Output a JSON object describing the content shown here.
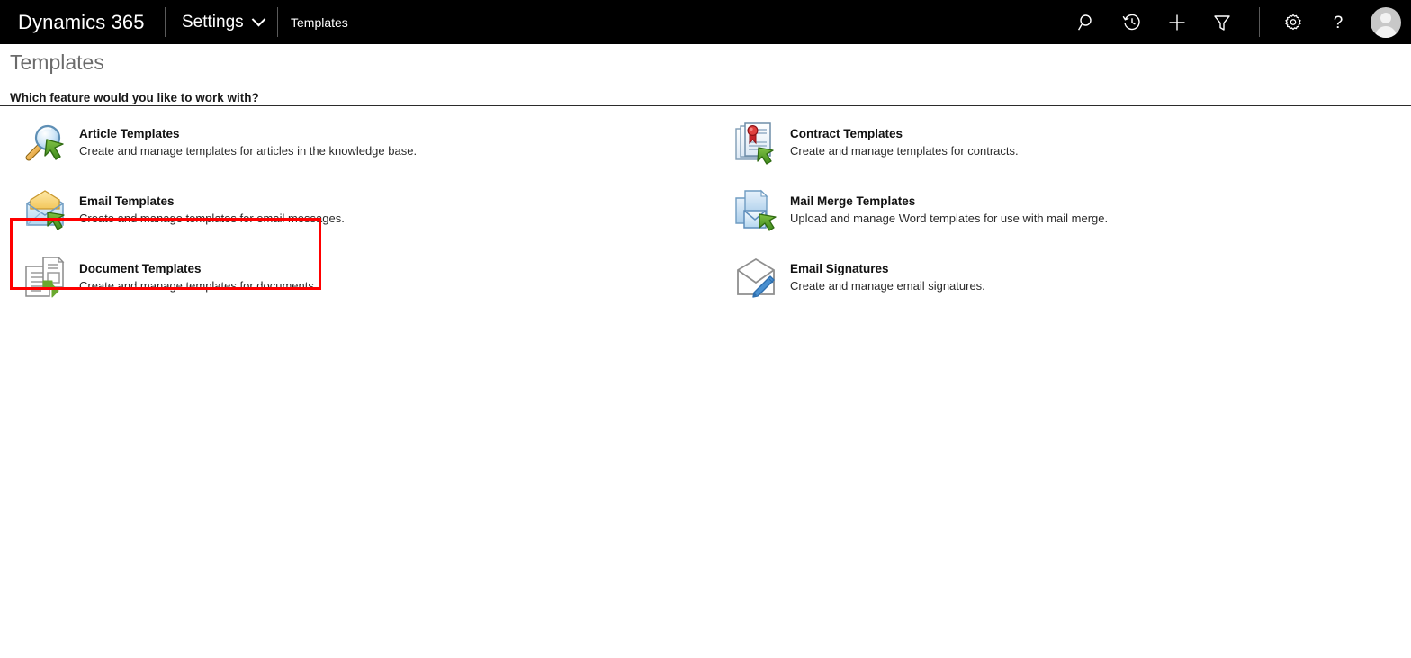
{
  "navbar": {
    "brand": "Dynamics 365",
    "module": "Settings",
    "module_chevron_icon": "chevron-down-icon",
    "breadcrumb": "Templates",
    "icons": [
      {
        "name": "search-icon",
        "label": "Search"
      },
      {
        "name": "history-icon",
        "label": "Recently viewed"
      },
      {
        "name": "plus-icon",
        "label": "Quick create"
      },
      {
        "name": "filter-icon",
        "label": "Filter"
      }
    ],
    "right_icons": [
      {
        "name": "gear-icon",
        "label": "Settings"
      },
      {
        "name": "help-icon",
        "label": "Help"
      }
    ],
    "avatar": {
      "name": "user-avatar",
      "label": "User profile"
    }
  },
  "page": {
    "title": "Templates",
    "question": "Which feature would you like to work with?"
  },
  "features": {
    "left": [
      {
        "id": "article-templates",
        "icon": "article-templates-icon",
        "title": "Article Templates",
        "description": "Create and manage templates for articles in the knowledge base."
      },
      {
        "id": "email-templates",
        "icon": "email-templates-icon",
        "title": "Email Templates",
        "description": "Create and manage templates for email messages."
      },
      {
        "id": "document-templates",
        "icon": "document-templates-icon",
        "title": "Document Templates",
        "description": "Create and manage templates for documents."
      }
    ],
    "right": [
      {
        "id": "contract-templates",
        "icon": "contract-templates-icon",
        "title": "Contract Templates",
        "description": "Create and manage templates for contracts."
      },
      {
        "id": "mail-merge-templates",
        "icon": "mail-merge-templates-icon",
        "title": "Mail Merge Templates",
        "description": "Upload and manage Word templates for use with mail merge."
      },
      {
        "id": "email-signatures",
        "icon": "email-signatures-icon",
        "title": "Email Signatures",
        "description": "Create and manage email signatures."
      }
    ]
  },
  "annotation": {
    "highlight_target": "document-templates",
    "highlight_color": "#ff0000"
  },
  "colors": {
    "navbar_background": "#000000",
    "page_background": "#ffffff",
    "title_text": "#6b6b6b",
    "body_text": "#2a2a2a",
    "rule": "#2b2b2b",
    "bottom_rule": "#c3d4e4",
    "accent_green": "#4f9c26",
    "accent_blue": "#3c7fc4",
    "accent_red": "#c5242a"
  }
}
